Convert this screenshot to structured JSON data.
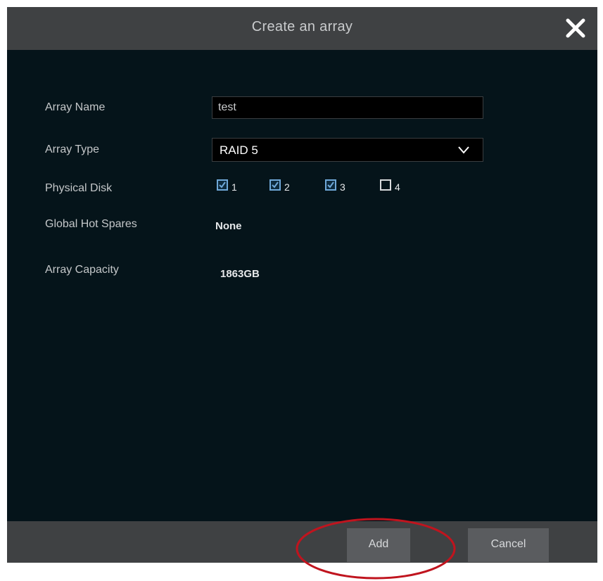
{
  "dialog": {
    "title": "Create an array",
    "close_icon": "close-icon"
  },
  "form": {
    "array_name": {
      "label": "Array Name",
      "value": "test"
    },
    "array_type": {
      "label": "Array Type",
      "value": "RAID 5",
      "icon": "chevron-down-icon"
    },
    "physical_disk": {
      "label": "Physical Disk",
      "disks": [
        {
          "number": "1",
          "checked": true
        },
        {
          "number": "2",
          "checked": true
        },
        {
          "number": "3",
          "checked": true
        },
        {
          "number": "4",
          "checked": false
        }
      ]
    },
    "global_hot_spares": {
      "label": "Global Hot Spares",
      "value": "None"
    },
    "array_capacity": {
      "label": "Array Capacity",
      "value": "1863GB"
    }
  },
  "buttons": {
    "add": "Add",
    "cancel": "Cancel"
  },
  "colors": {
    "dialog_background": "#05141a",
    "bar_background": "#3f4143",
    "button_background": "#5a5c5f",
    "checkbox_accent": "#6fa8d8",
    "highlight_ring": "#c0141e"
  }
}
